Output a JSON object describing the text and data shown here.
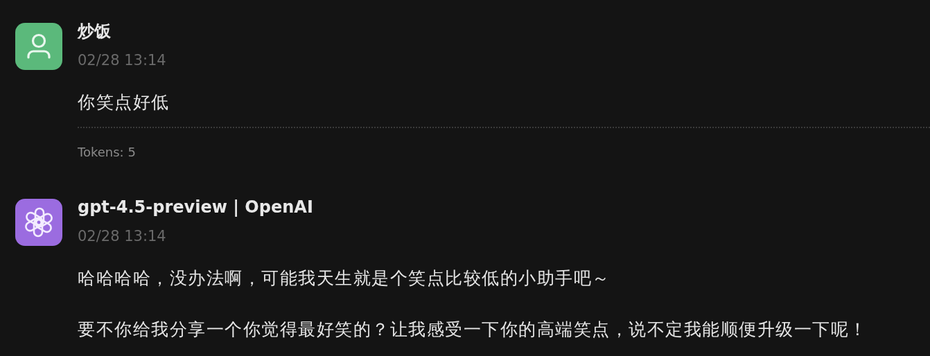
{
  "messages": [
    {
      "kind": "user",
      "color": "#5bb97b",
      "author": "炒饭",
      "time": "02/28 13:14",
      "paragraphs": [
        "你笑点好低"
      ],
      "tokens": "Tokens: 5"
    },
    {
      "kind": "assistant",
      "color": "#9b6ce0",
      "author": "gpt-4.5-preview | OpenAI",
      "time": "02/28 13:14",
      "paragraphs": [
        "哈哈哈哈，没办法啊，可能我天生就是个笑点比较低的小助手吧～",
        "要不你给我分享一个你觉得最好笑的？让我感受一下你的高端笑点，说不定我能顺便升级一下呢！"
      ]
    }
  ]
}
